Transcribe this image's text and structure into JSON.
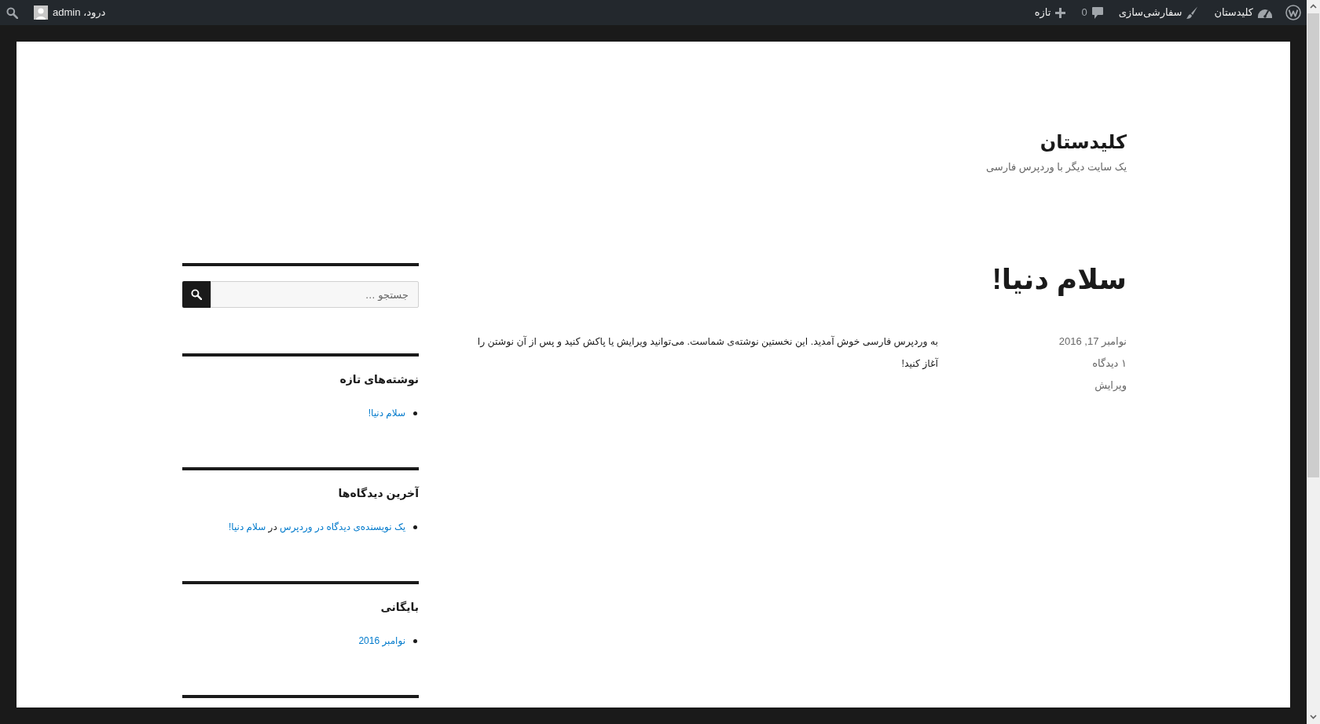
{
  "admin_bar": {
    "items": [
      {
        "kind": "site",
        "label": "کلیدستان"
      },
      {
        "kind": "customize",
        "label": "سفارشی‌سازی"
      },
      {
        "kind": "comments",
        "label": "0"
      },
      {
        "kind": "new",
        "label": "تازه"
      }
    ],
    "account": {
      "greeting": "درود، admin"
    }
  },
  "site": {
    "title": "کلیدستان",
    "tagline": "یک سایت دیگر با وردپرس فارسی"
  },
  "post": {
    "title": "سلام دنیا!",
    "meta": [
      "نوامبر 17, 2016",
      "۱ دیدگاه",
      "ویرایش"
    ],
    "content": "به وردپرس فارسی خوش آمدید. این نخستین نوشته‌ی شماست. می‌توانید ویرایش یا پاکش کنید و پس از آن نوشتن را آغاز کنید!"
  },
  "sidebar": {
    "widgets": [
      {
        "kind": "search",
        "placeholder": "جستجو …"
      },
      {
        "kind": "links",
        "title": "نوشته‌های تازه",
        "items": [
          "سلام دنیا!"
        ]
      },
      {
        "kind": "comments",
        "title": "آخرین دیدگاه‌ها",
        "items": [
          {
            "author": "یک نویسنده‌ی دیدگاه در وردپرس",
            "connector": "در",
            "post": "سلام دنیا!"
          }
        ]
      },
      {
        "kind": "links",
        "title": "بایگانی",
        "items": [
          "نوامبر 2016"
        ]
      }
    ]
  }
}
